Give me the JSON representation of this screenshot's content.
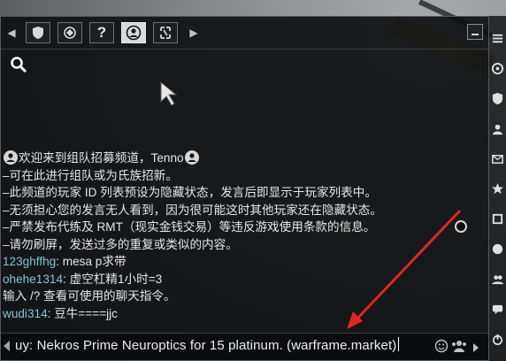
{
  "tabs": [
    {
      "name": "clan-shield",
      "icon": "shield-icon"
    },
    {
      "name": "alliance",
      "icon": "alliance-icon"
    },
    {
      "name": "help",
      "icon": "question-icon",
      "label": "?"
    },
    {
      "name": "recruiting",
      "icon": "recruit-icon",
      "active": true
    },
    {
      "name": "trading",
      "icon": "trade-icon"
    }
  ],
  "messages": [
    {
      "type": "system",
      "text": "欢迎来到组队招募频道，Tenno",
      "icons": true
    },
    {
      "type": "system",
      "text": "–可在此进行组队或为氏族招新。"
    },
    {
      "type": "system",
      "text": "–此频道的玩家 ID 列表预设为隐藏状态，发言后即显示于玩家列表中。"
    },
    {
      "type": "system",
      "text": "–无须担心您的发言无人看到，因为很可能这时其他玩家还在隐藏状态。"
    },
    {
      "type": "system",
      "text": "–严禁发布代练及 RMT（现实金钱交易）等违反游戏使用条款的信息。"
    },
    {
      "type": "system",
      "text": "–请勿刷屏，发送过多的重复或类似的内容。"
    },
    {
      "type": "user",
      "user": "123ghffhg",
      "text": ": mesa p求带"
    },
    {
      "type": "user",
      "user": "ohehe1314",
      "text": ": 虚空杠精1小时=3"
    },
    {
      "type": "system",
      "text": "输入 /? 查看可使用的聊天指令。"
    },
    {
      "type": "user",
      "user": "wudi314",
      "text": ": 豆牛====jjc"
    }
  ],
  "input": {
    "value": "uy: Nekros Prime Neuroptics for 15 platinum. (warframe.market)"
  },
  "colors": {
    "accent_user": "#7dc7cf",
    "annotation": "#e0261f",
    "panel_bg": "#0e1012"
  }
}
